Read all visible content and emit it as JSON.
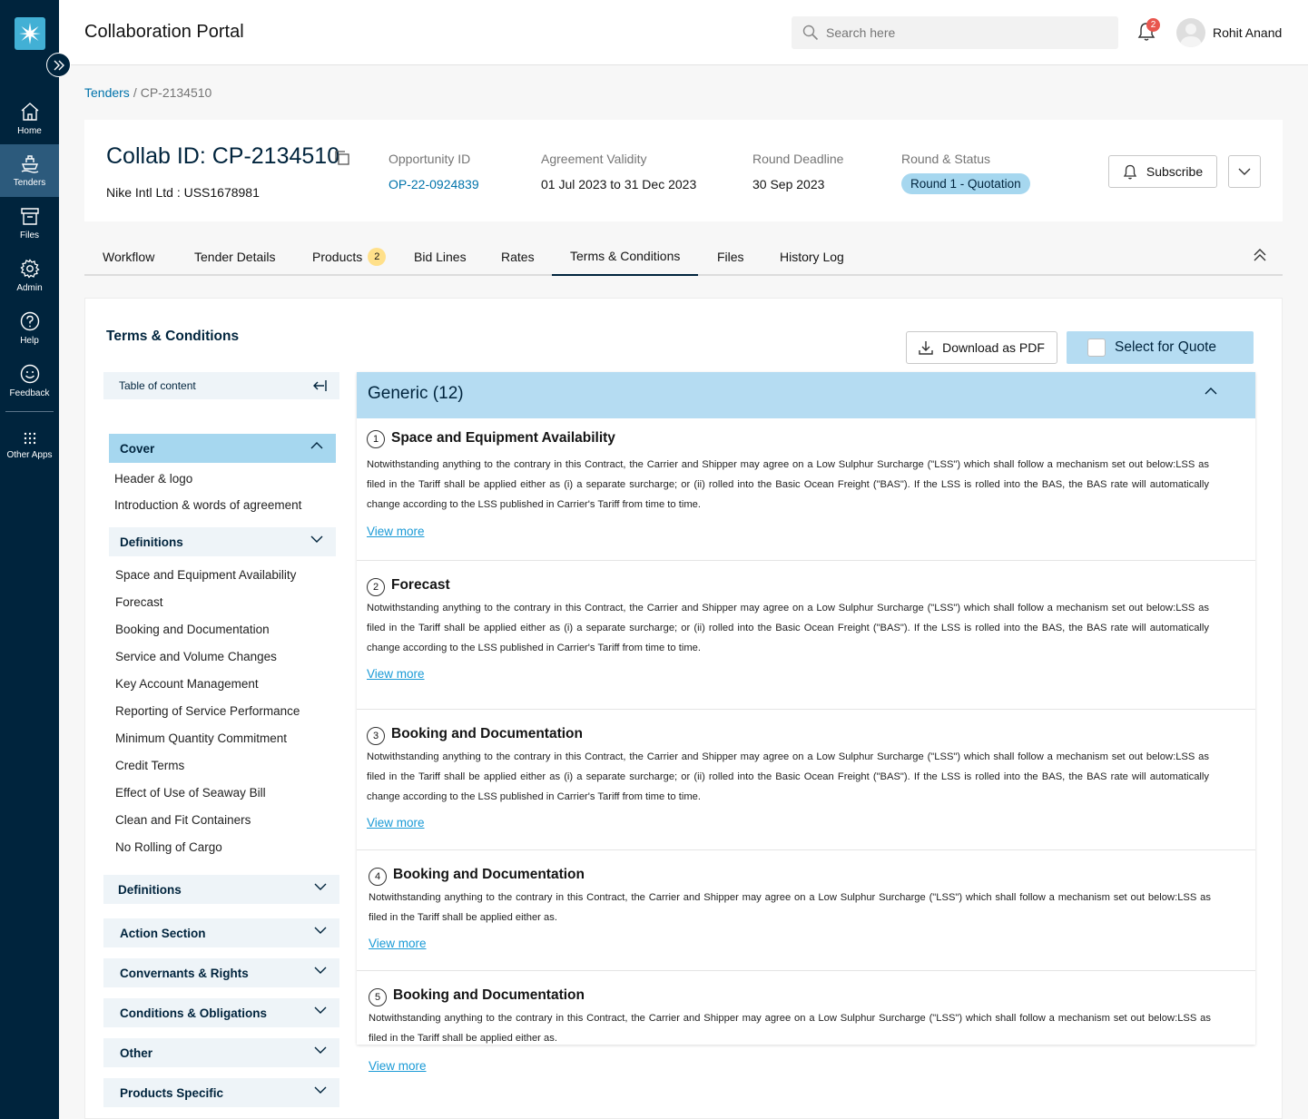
{
  "app": {
    "title": "Collaboration Portal"
  },
  "nav": {
    "items": [
      {
        "label": "Home",
        "icon": "home-icon"
      },
      {
        "label": "Tenders",
        "icon": "ship-icon"
      },
      {
        "label": "Files",
        "icon": "archive-icon"
      },
      {
        "label": "Admin",
        "icon": "gear-icon"
      },
      {
        "label": "Help",
        "icon": "help-icon"
      },
      {
        "label": "Feedback",
        "icon": "smile-icon"
      },
      {
        "label": "Other Apps",
        "icon": "grid-icon"
      }
    ],
    "active": "Tenders"
  },
  "header": {
    "search_placeholder": "Search here",
    "notification_count": "2",
    "user_name": "Rohit Anand"
  },
  "breadcrumb": {
    "root": "Tenders",
    "current": "CP-2134510"
  },
  "summary": {
    "collab_id": "Collab ID: CP-2134510",
    "customer": "Nike Intl Ltd : USS1678981",
    "opportunity_label": "Opportunity ID",
    "opportunity_value": "OP-22-0924839",
    "validity_label": "Agreement Validity",
    "validity_value": "01 Jul 2023 to 31 Dec 2023",
    "deadline_label": "Round Deadline",
    "deadline_value": "30 Sep 2023",
    "status_label": "Round & Status",
    "status_value": "Round 1 - Quotation",
    "subscribe_label": "Subscribe"
  },
  "tabs": [
    {
      "label": "Workflow"
    },
    {
      "label": "Tender Details"
    },
    {
      "label": "Products",
      "count": "2"
    },
    {
      "label": "Bid Lines"
    },
    {
      "label": "Rates"
    },
    {
      "label": "Terms & Conditions",
      "active": true
    },
    {
      "label": "Files"
    },
    {
      "label": "History Log"
    }
  ],
  "terms": {
    "title": "Terms & Conditions",
    "download_label": "Download as PDF",
    "quote_label": "Select for Quote",
    "toc": {
      "header": "Table of content",
      "cover": {
        "title": "Cover",
        "items": [
          "Header & logo",
          "Introduction & words of agreement"
        ]
      },
      "definitions_open": {
        "title": "Definitions",
        "items": [
          "Space and Equipment Availability",
          "Forecast",
          "Booking and Documentation",
          "Service and Volume Changes",
          "Key Account Management",
          "Reporting of Service Performance",
          "Minimum Quantity Commitment",
          "Credit Terms",
          "Effect of Use of Seaway Bill",
          "Clean and Fit Containers",
          "No Rolling of Cargo"
        ]
      },
      "sections": [
        "Definitions",
        "Action Section",
        "Convernants & Rights",
        "Conditions & Obligations",
        "Other",
        "Products Specific"
      ]
    },
    "group_title": "Generic (12)",
    "clauses": [
      {
        "num": "1",
        "title": "Space and Equipment Availability",
        "body": "Notwithstanding anything to the contrary in this Contract, the Carrier and Shipper may agree on a Low Sulphur Surcharge (\"LSS\") which shall follow a mechanism set out below:LSS as filed in the Tariff shall be applied either as (i) a separate surcharge; or (ii) rolled into the Basic Ocean Freight (\"BAS\"). If the LSS is rolled into the BAS, the BAS rate will automatically change according to the LSS published in Carrier's Tariff from time to time.",
        "more": "View more"
      },
      {
        "num": "2",
        "title": "Forecast",
        "body": "Notwithstanding anything to the contrary in this Contract, the Carrier and Shipper may agree on a Low Sulphur Surcharge (\"LSS\") which shall follow a mechanism set out below:LSS as filed in the Tariff shall be applied either as (i) a separate surcharge; or (ii) rolled into the Basic Ocean Freight (\"BAS\"). If the LSS is rolled into the BAS, the BAS rate will automatically change according to the LSS published in Carrier's Tariff from time to time.",
        "more": "View more"
      },
      {
        "num": "3",
        "title": "Booking and Documentation",
        "body": "Notwithstanding anything to the contrary in this Contract, the Carrier and Shipper may agree on a Low Sulphur Surcharge (\"LSS\") which shall follow a mechanism set out below:LSS as filed in the Tariff shall be applied either as (i) a separate surcharge; or (ii) rolled into the Basic Ocean Freight (\"BAS\"). If the LSS is rolled into the BAS, the BAS rate will automatically change according to the LSS published in Carrier's Tariff from time to time.",
        "more": "View more"
      },
      {
        "num": "4",
        "title": "Booking and Documentation",
        "body": "Notwithstanding anything to the contrary in this Contract, the Carrier and Shipper may agree on a Low Sulphur Surcharge (\"LSS\") which shall follow a mechanism set out below:LSS as filed in the Tariff shall be applied either as.",
        "more": "View more"
      },
      {
        "num": "5",
        "title": "Booking and Documentation",
        "body": "Notwithstanding anything to the contrary in this Contract, the Carrier and Shipper may agree on a Low Sulphur Surcharge (\"LSS\") which shall follow a mechanism set out below:LSS as filed in the Tariff shall be applied either as.",
        "more": "View more"
      }
    ]
  }
}
